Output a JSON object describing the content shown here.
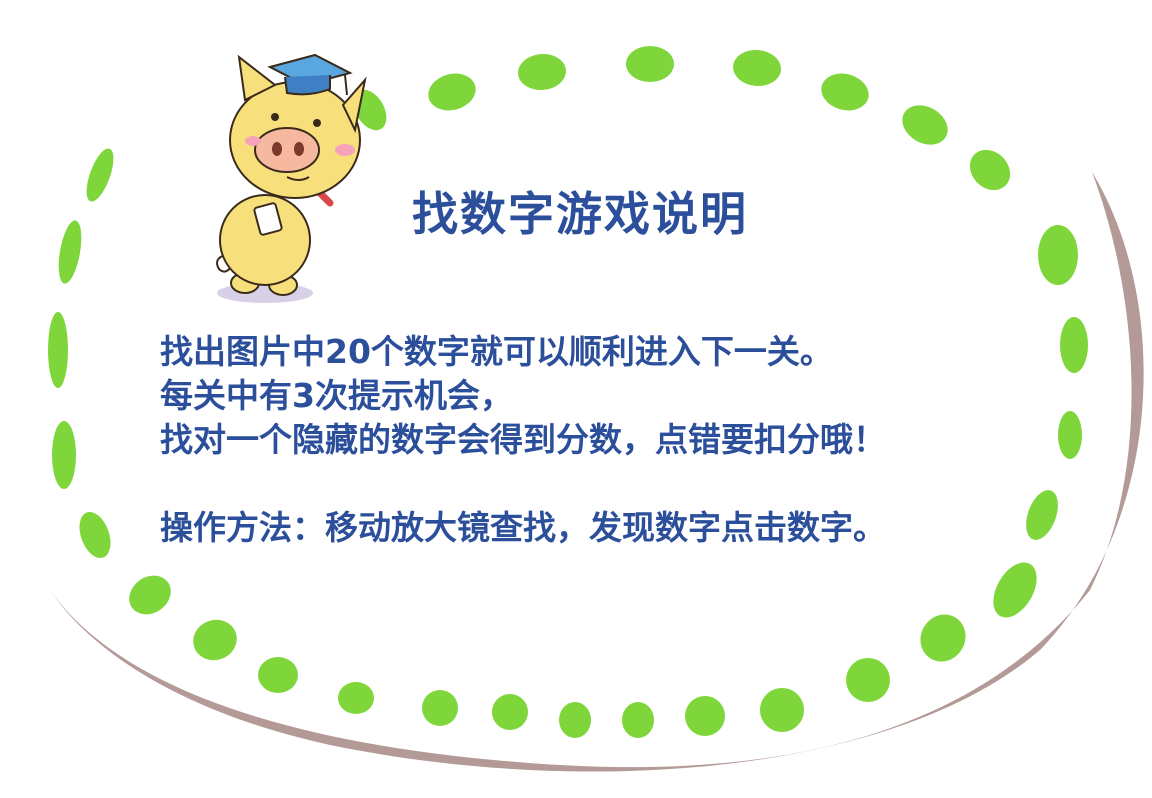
{
  "instructions": {
    "title": "找数字游戏说明",
    "lines": [
      "找出图片中20个数字就可以顺利进入下一关。",
      "每关中有3次提示机会，",
      "找对一个隐藏的数字会得到分数，点错要扣分哦！"
    ],
    "operation": "操作方法：移动放大镜查找，发现数字点击数字。"
  },
  "colors": {
    "text": "#2c4f9b",
    "dash": "#7ed63a",
    "shadow": "#b39a96",
    "pig": "#f7e07c"
  }
}
